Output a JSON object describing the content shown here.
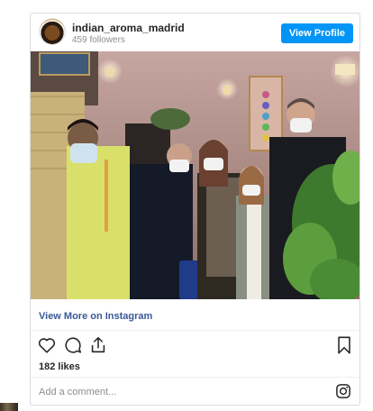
{
  "post": {
    "username": "indian_aroma_madrid",
    "followers": "459 followers",
    "view_profile_label": "View Profile",
    "view_more_label": "View More on Instagram",
    "likes": "182 likes",
    "comment_placeholder": "Add a comment..."
  },
  "icons": {
    "like": "heart-icon",
    "comment": "comment-icon",
    "share": "share-icon",
    "save": "bookmark-icon",
    "brand": "instagram-icon"
  },
  "colors": {
    "accent": "#0095f6",
    "link": "#385898",
    "muted": "#8e8e8e",
    "border": "#dbdbdb"
  }
}
